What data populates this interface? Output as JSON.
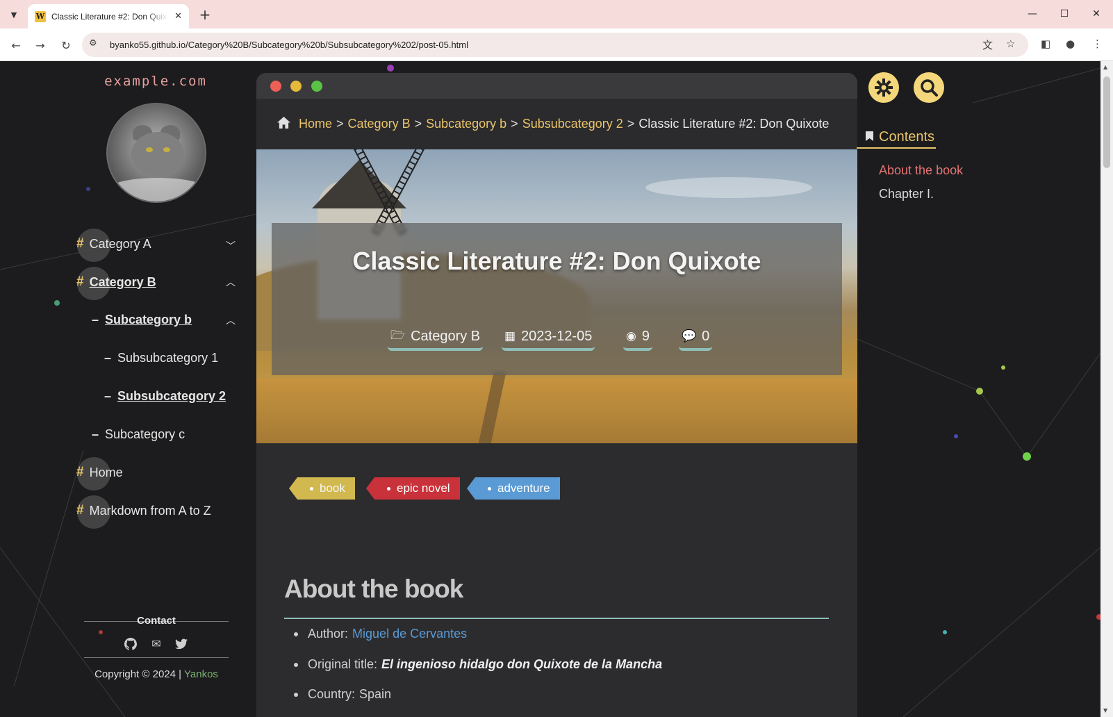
{
  "browser": {
    "tab_title": "Classic Literature #2: Don Quixote",
    "favicon_letter": "W",
    "url": "byanko55.github.io/Category%20B/Subcategory%20b/Subsubcategory%202/post-05.html"
  },
  "sidebar": {
    "site_name": "example.com",
    "nav": [
      {
        "label": "Category A",
        "level": 0,
        "expanded": false
      },
      {
        "label": "Category B",
        "level": 0,
        "expanded": true,
        "active": true
      },
      {
        "label": "Subcategory b",
        "level": 1,
        "expanded": true,
        "active": true
      },
      {
        "label": "Subsubcategory 1",
        "level": 2
      },
      {
        "label": "Subsubcategory 2",
        "level": 2,
        "active": true
      },
      {
        "label": "Subcategory c",
        "level": 1
      },
      {
        "label": "Home",
        "level": 0
      },
      {
        "label": "Markdown from A to Z",
        "level": 0
      }
    ],
    "contact_title": "Contact",
    "social_icons": [
      "github-icon",
      "envelope-icon",
      "twitter-icon"
    ],
    "copyright_prefix": "Copyright © 2024 |",
    "copyright_author": "Yankos"
  },
  "post": {
    "breadcrumb": [
      "Home",
      "Category B",
      "Subcategory b",
      "Subsubcategory 2"
    ],
    "breadcrumb_current": "Classic Literature #2: Don Quixote",
    "title": "Classic Literature #2: Don Quixote",
    "category": "Category B",
    "date": "2023-12-05",
    "views": "9",
    "comments": "0",
    "tags": [
      "book",
      "epic novel",
      "adventure"
    ],
    "section_heading": "About the book",
    "details": {
      "author_label": "Author:",
      "author_value": "Miguel de Cervantes",
      "original_title_label": "Original title:",
      "original_title_value": "El ingenioso hidalgo don Quixote de la Mancha",
      "country_label": "Country:",
      "country_value": "Spain"
    }
  },
  "toc": {
    "title": "Contents",
    "items": [
      "About the book",
      "Chapter I."
    ]
  },
  "colors": {
    "accent": "#e9c46a",
    "toc_active": "#e57373",
    "tag_book": "#d1b84f",
    "tag_epic": "#c9323a",
    "tag_adventure": "#5b9bd5"
  }
}
